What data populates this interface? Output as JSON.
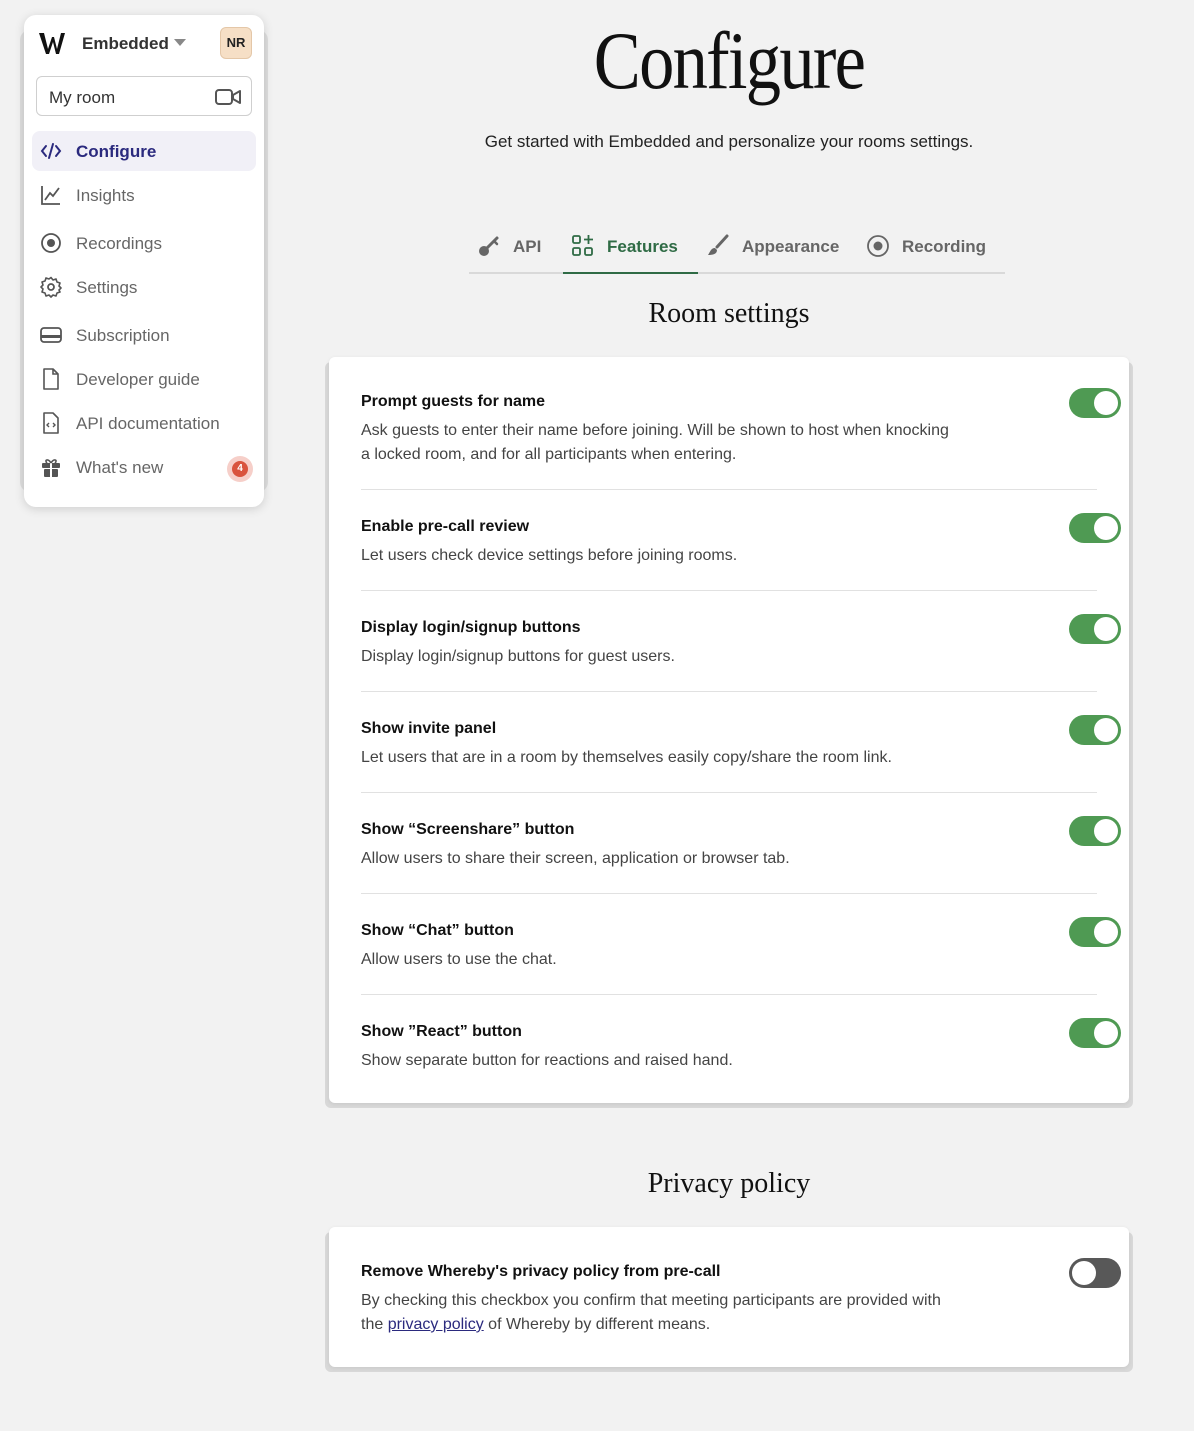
{
  "sidebar": {
    "org_name": "Embedded",
    "avatar_initials": "NR",
    "room": "My room",
    "items": [
      {
        "label": "Configure",
        "icon": "code-icon",
        "active": true
      },
      {
        "label": "Insights",
        "icon": "chart-line-icon"
      },
      {
        "label": "Recordings",
        "icon": "record-icon"
      },
      {
        "label": "Settings",
        "icon": "gear-icon"
      },
      {
        "label": "Subscription",
        "icon": "credit-card-icon"
      },
      {
        "label": "Developer guide",
        "icon": "document-icon"
      },
      {
        "label": "API documentation",
        "icon": "code-document-icon"
      },
      {
        "label": "What's new",
        "icon": "gift-icon",
        "badge": "4"
      }
    ]
  },
  "page": {
    "title": "Configure",
    "subtitle": "Get started with Embedded and personalize your rooms settings."
  },
  "tabs": [
    {
      "label": "API",
      "icon": "key-icon"
    },
    {
      "label": "Features",
      "icon": "features-grid-icon",
      "active": true
    },
    {
      "label": "Appearance",
      "icon": "paintbrush-icon"
    },
    {
      "label": "Recording",
      "icon": "record-icon"
    }
  ],
  "room_settings": {
    "title": "Room settings",
    "rows": [
      {
        "title": "Prompt guests for name",
        "desc": "Ask guests to enter their name before joining. Will be shown to host when knocking a locked room, and for all participants when entering.",
        "enabled": true
      },
      {
        "title": "Enable pre-call review",
        "desc": "Let users check device settings before joining rooms.",
        "enabled": true
      },
      {
        "title": "Display login/signup buttons",
        "desc": "Display login/signup buttons for guest users.",
        "enabled": true
      },
      {
        "title": "Show invite panel",
        "desc": "Let users that are in a room by themselves easily copy/share the room link.",
        "enabled": true
      },
      {
        "title": "Show “Screenshare” button",
        "desc": "Allow users to share their screen, application or browser tab.",
        "enabled": true
      },
      {
        "title": "Show “Chat” button",
        "desc": "Allow users to use the chat.",
        "enabled": true
      },
      {
        "title": "Show ”React” button",
        "desc": "Show separate button for reactions and raised hand.",
        "enabled": true
      }
    ]
  },
  "privacy": {
    "title": "Privacy policy",
    "row_title": "Remove Whereby's privacy policy from pre-call",
    "desc_before": "By checking this checkbox you confirm that meeting participants are provided with the ",
    "link": "privacy policy",
    "desc_after": " of Whereby by different means.",
    "enabled": false
  },
  "colors": {
    "accent_green": "#4f9a53",
    "nav_active": "#2b2a7e",
    "badge": "#d9533d"
  }
}
